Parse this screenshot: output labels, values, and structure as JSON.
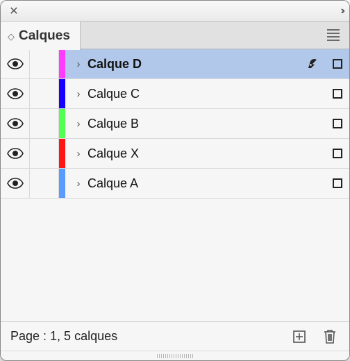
{
  "titlebar": {
    "close_glyph": "✕",
    "collapse_glyph": "››"
  },
  "panel": {
    "tab_label": "Calques",
    "sort_glyph": "◇"
  },
  "layers": [
    {
      "name": "Calque D",
      "color": "#ff3cff",
      "visible": true,
      "selected": true,
      "active": true
    },
    {
      "name": "Calque C",
      "color": "#1600ff",
      "visible": true,
      "selected": false,
      "active": false
    },
    {
      "name": "Calque B",
      "color": "#54ff54",
      "visible": true,
      "selected": false,
      "active": false
    },
    {
      "name": "Calque X",
      "color": "#ff1515",
      "visible": true,
      "selected": false,
      "active": false
    },
    {
      "name": "Calque A",
      "color": "#5a9bff",
      "visible": true,
      "selected": false,
      "active": false
    }
  ],
  "disclosure_glyph": "›",
  "footer": {
    "status": "Page : 1, 5 calques"
  }
}
